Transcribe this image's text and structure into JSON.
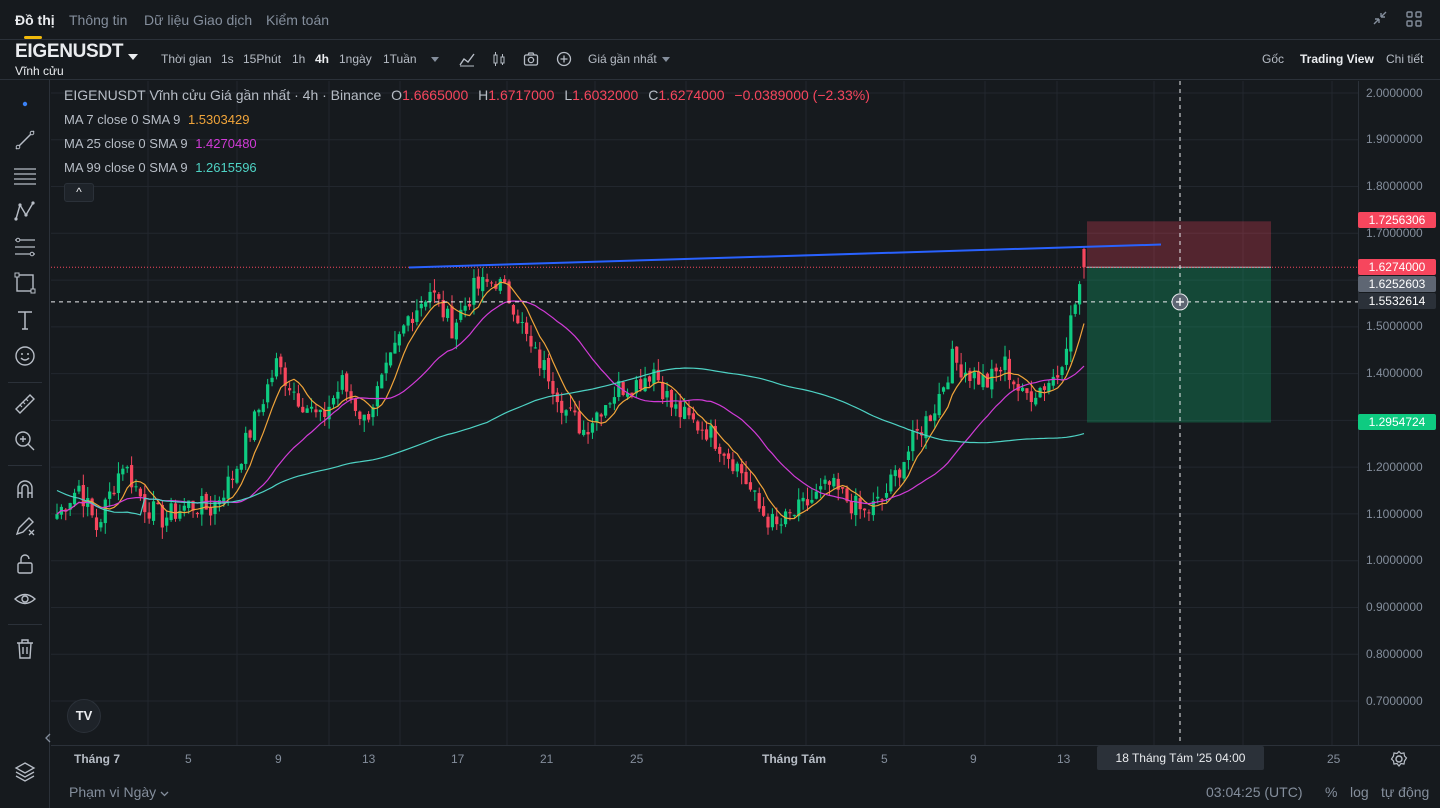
{
  "tabs": [
    "Đồ thị",
    "Thông tin",
    "Dữ liệu Giao dịch",
    "Kiểm toán"
  ],
  "colors": {
    "accent": "#f0b90b",
    "up": "#0ecb81",
    "down": "#f6465d",
    "ma7": "#f0a43a",
    "ma25": "#d13bd7",
    "ma99": "#4ed2c4",
    "trendline": "#2962ff"
  },
  "symbol": {
    "name": "EIGENUSDT",
    "sub": "Vĩnh cửu"
  },
  "toolbar": {
    "time_label": "Thời gian",
    "intervals": [
      "1s",
      "15Phút",
      "1h",
      "4h",
      "1ngày",
      "1Tuần"
    ],
    "active_interval": "4h",
    "price_type": "Giá gần nhất",
    "views": [
      "Gốc",
      "Trading View",
      "Chi tiết"
    ],
    "active_view": "Trading View"
  },
  "legend": {
    "title": "EIGENUSDT Vĩnh cửu Giá gần nhất · 4h · Binance",
    "o_label": "O",
    "o": "1.6665000",
    "h_label": "H",
    "h": "1.6717000",
    "l_label": "L",
    "l": "1.6032000",
    "c_label": "C",
    "c": "1.6274000",
    "change": "−0.0389000 (−2.33%)",
    "ma7_label": "MA 7 close 0 SMA 9",
    "ma7": "1.5303429",
    "ma25_label": "MA 25 close 0 SMA 9",
    "ma25": "1.4270480",
    "ma99_label": "MA 99 close 0 SMA 9",
    "ma99": "1.2615596"
  },
  "collapse_glyph": "^",
  "price_axis": {
    "ticks": [
      "2.0000000",
      "1.9000000",
      "1.8000000",
      "1.7000000",
      "1.5000000",
      "1.4000000",
      "1.2000000",
      "1.1000000",
      "1.0000000",
      "0.9000000",
      "0.8000000",
      "0.7000000"
    ],
    "stop_price": "1.7256306",
    "last_price": "1.6274000",
    "mark_price": "1.6252603",
    "crosshair_price": "1.5532614",
    "target_price": "1.2954724"
  },
  "time_axis": {
    "labels": [
      "Tháng 7",
      "5",
      "9",
      "13",
      "17",
      "21",
      "25",
      "Tháng Tám",
      "5",
      "9",
      "13",
      "25"
    ],
    "crosshair_time": "18 Tháng Tám '25   04:00"
  },
  "bottom": {
    "range": "Phạm vi Ngày",
    "clock": "03:04:25 (UTC)",
    "percent": "%",
    "log": "log",
    "auto": "tự động"
  },
  "tv_logo": "TV",
  "chart_data": {
    "type": "candlestick",
    "symbol": "EIGENUSDT",
    "interval": "4h",
    "ylim": [
      0.65,
      2.05
    ],
    "last": {
      "open": 1.6665,
      "high": 1.6717,
      "low": 1.6032,
      "close": 1.6274
    },
    "indicators": [
      {
        "name": "MA 7",
        "value": 1.5303429
      },
      {
        "name": "MA 25",
        "value": 1.427048
      },
      {
        "name": "MA 99",
        "value": 1.2615596
      }
    ],
    "position": {
      "entry": 1.6274,
      "stop": 1.7256306,
      "target": 1.2954724
    },
    "close_path": [
      {
        "t": 0,
        "p": 1.1
      },
      {
        "t": 5,
        "p": 1.16
      },
      {
        "t": 9,
        "p": 1.07
      },
      {
        "t": 15,
        "p": 1.21
      },
      {
        "t": 20,
        "p": 1.12
      },
      {
        "t": 24,
        "p": 1.09
      },
      {
        "t": 30,
        "p": 1.12
      },
      {
        "t": 35,
        "p": 1.11
      },
      {
        "t": 40,
        "p": 1.18
      },
      {
        "t": 45,
        "p": 1.3
      },
      {
        "t": 50,
        "p": 1.42
      },
      {
        "t": 55,
        "p": 1.35
      },
      {
        "t": 60,
        "p": 1.3
      },
      {
        "t": 65,
        "p": 1.38
      },
      {
        "t": 70,
        "p": 1.3
      },
      {
        "t": 75,
        "p": 1.4
      },
      {
        "t": 80,
        "p": 1.52
      },
      {
        "t": 85,
        "p": 1.58
      },
      {
        "t": 90,
        "p": 1.5
      },
      {
        "t": 95,
        "p": 1.58
      },
      {
        "t": 100,
        "p": 1.6
      },
      {
        "t": 104,
        "p": 1.55
      },
      {
        "t": 108,
        "p": 1.45
      },
      {
        "t": 112,
        "p": 1.4
      },
      {
        "t": 116,
        "p": 1.32
      },
      {
        "t": 120,
        "p": 1.28
      },
      {
        "t": 124,
        "p": 1.33
      },
      {
        "t": 128,
        "p": 1.37
      },
      {
        "t": 132,
        "p": 1.38
      },
      {
        "t": 136,
        "p": 1.41
      },
      {
        "t": 140,
        "p": 1.33
      },
      {
        "t": 144,
        "p": 1.3
      },
      {
        "t": 148,
        "p": 1.28
      },
      {
        "t": 152,
        "p": 1.24
      },
      {
        "t": 156,
        "p": 1.19
      },
      {
        "t": 160,
        "p": 1.11
      },
      {
        "t": 164,
        "p": 1.07
      },
      {
        "t": 168,
        "p": 1.1
      },
      {
        "t": 172,
        "p": 1.13
      },
      {
        "t": 176,
        "p": 1.16
      },
      {
        "t": 180,
        "p": 1.13
      },
      {
        "t": 184,
        "p": 1.1
      },
      {
        "t": 188,
        "p": 1.13
      },
      {
        "t": 192,
        "p": 1.2
      },
      {
        "t": 196,
        "p": 1.27
      },
      {
        "t": 200,
        "p": 1.33
      },
      {
        "t": 204,
        "p": 1.43
      },
      {
        "t": 208,
        "p": 1.4
      },
      {
        "t": 212,
        "p": 1.38
      },
      {
        "t": 216,
        "p": 1.42
      },
      {
        "t": 220,
        "p": 1.35
      },
      {
        "t": 224,
        "p": 1.37
      },
      {
        "t": 228,
        "p": 1.4
      },
      {
        "t": 232,
        "p": 1.55
      },
      {
        "t": 234,
        "p": 1.6274
      }
    ]
  }
}
